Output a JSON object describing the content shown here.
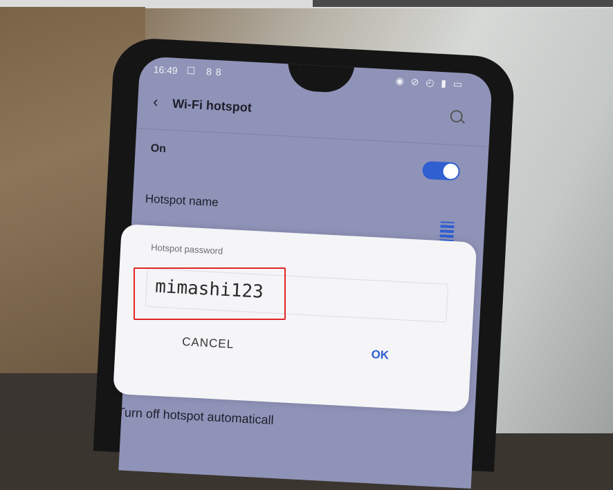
{
  "status": {
    "time": "16:49",
    "left_icons": "☐ 88",
    "right_icons": "◉ ⊘ ◴ ▮ ▭"
  },
  "header": {
    "title": "Wi-Fi hotspot"
  },
  "settings": {
    "on_label": "On",
    "hotspot_name_label": "Hotspot name",
    "bottom_label": "Turn off hotspot automaticall"
  },
  "dialog": {
    "title": "Hotspot password",
    "password_value": "mimashi123",
    "cancel_label": "CANCEL",
    "ok_label": "OK"
  },
  "toggle": {
    "state": "on",
    "color": "#2f5fd0"
  },
  "highlight": {
    "color": "#e02424"
  }
}
